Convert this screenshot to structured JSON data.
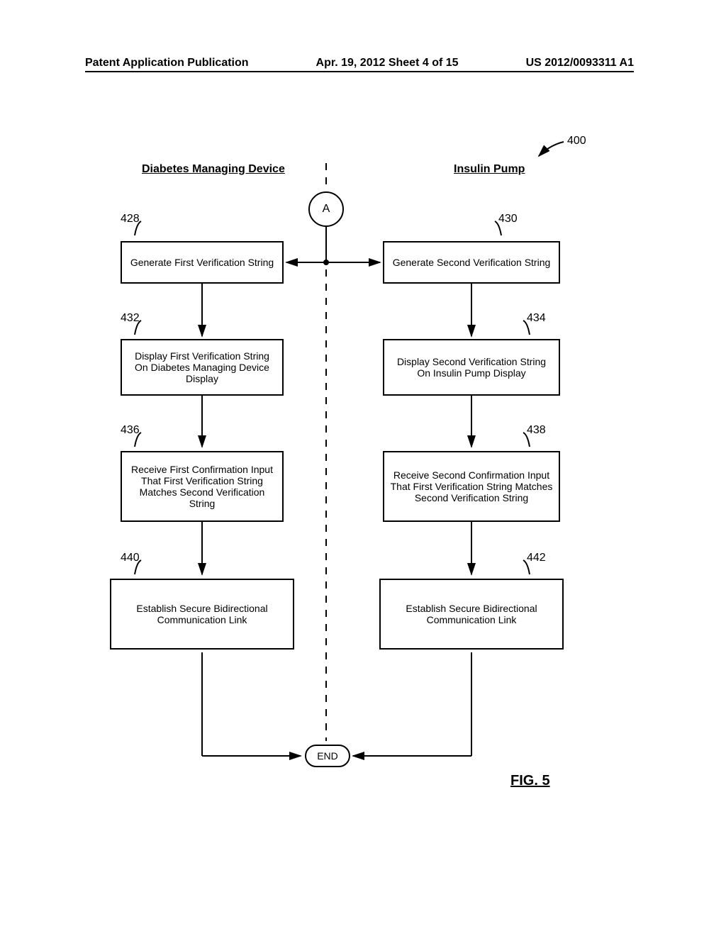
{
  "header": {
    "left": "Patent Application Publication",
    "center": "Apr. 19, 2012   Sheet 4 of 15",
    "right": "US 2012/0093311 A1"
  },
  "diagram": {
    "ref_main": "400",
    "title_left": "Diabetes Managing Device",
    "title_right": "Insulin Pump",
    "connector_a": "A",
    "boxes": {
      "b428": {
        "label": "428",
        "text": "Generate First Verification String"
      },
      "b430": {
        "label": "430",
        "text": "Generate Second Verification String"
      },
      "b432": {
        "label": "432",
        "text": "Display First Verification String On Diabetes Managing Device Display"
      },
      "b434": {
        "label": "434",
        "text": "Display Second Verification String On Insulin Pump Display"
      },
      "b436": {
        "label": "436",
        "text": "Receive First Confirmation Input That  First Verification String Matches Second Verification String"
      },
      "b438": {
        "label": "438",
        "text": "Receive Second Confirmation Input That  First Verification String Matches Second Verification String"
      },
      "b440": {
        "label": "440",
        "text": "Establish Secure Bidirectional Communication Link"
      },
      "b442": {
        "label": "442",
        "text": "Establish Secure Bidirectional Communication Link"
      }
    },
    "end": "END",
    "figure": "FIG. 5"
  }
}
